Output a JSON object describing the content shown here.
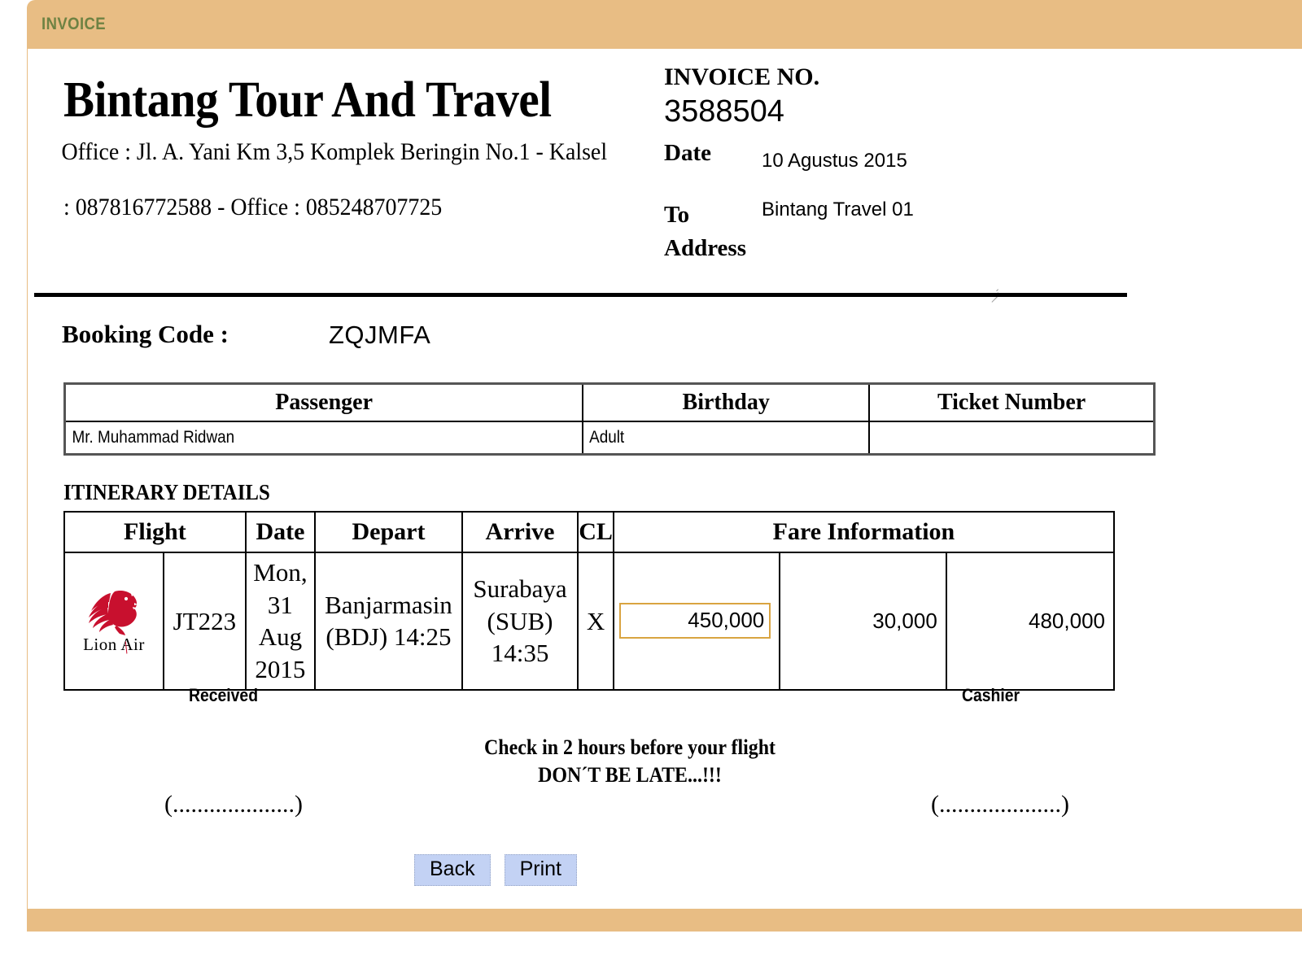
{
  "panel": {
    "title": "INVOICE",
    "accent_color": "#e8bd84",
    "title_color": "#6e8243"
  },
  "company": {
    "name": "Bintang Tour And Travel",
    "address_line1": "Office : Jl. A. Yani Km 3,5 Komplek Beringin No.1 -",
    "address_line2": "Kalsel",
    "phone_line": ": 087816772588 - Office : 085248707725"
  },
  "invoice": {
    "number_label": "INVOICE NO.",
    "number": "3588504",
    "date_label": "Date",
    "date_value": "10 Agustus 2015",
    "to_address_label": "To Address",
    "to_label_line1": "To",
    "to_label_line2": "Address",
    "to_address_value": "Bintang Travel 01"
  },
  "booking": {
    "label": "Booking Code :",
    "value": "ZQJMFA"
  },
  "passenger_table": {
    "headers": [
      "Passenger",
      "Birthday",
      "Ticket Number"
    ],
    "rows": [
      {
        "passenger": "Mr. Muhammad Ridwan",
        "birthday": "Adult",
        "ticket_number": ""
      }
    ]
  },
  "itinerary": {
    "section_title": "ITINERARY DETAILS",
    "headers": [
      "Flight",
      "Date",
      "Depart",
      "Arrive",
      "CL",
      "Fare Information"
    ],
    "rows": [
      {
        "airline": "Lion Air",
        "airline_logo": "lion-air-logo",
        "flight_no": "JT223",
        "date": "Mon, 31 Aug 2015",
        "depart": "Banjarmasin (BDJ) 14:25",
        "arrive": "Surabaya (SUB) 14:35",
        "cl": "X",
        "fare_base": "450,000",
        "fare_tax": "30,000",
        "fare_total": "480,000",
        "fare_focus_border_color": "#d9a441"
      }
    ]
  },
  "signatures": {
    "received_label": "Received",
    "cashier_label": "Cashier",
    "received_line": "(....................)",
    "cashier_line": "(....................)"
  },
  "notice": {
    "line1": "Check in 2 hours before your flight",
    "line2": "DON´T BE LATE...!!!"
  },
  "buttons": {
    "back": "Back",
    "print": "Print",
    "color": "#c3d2f4"
  }
}
